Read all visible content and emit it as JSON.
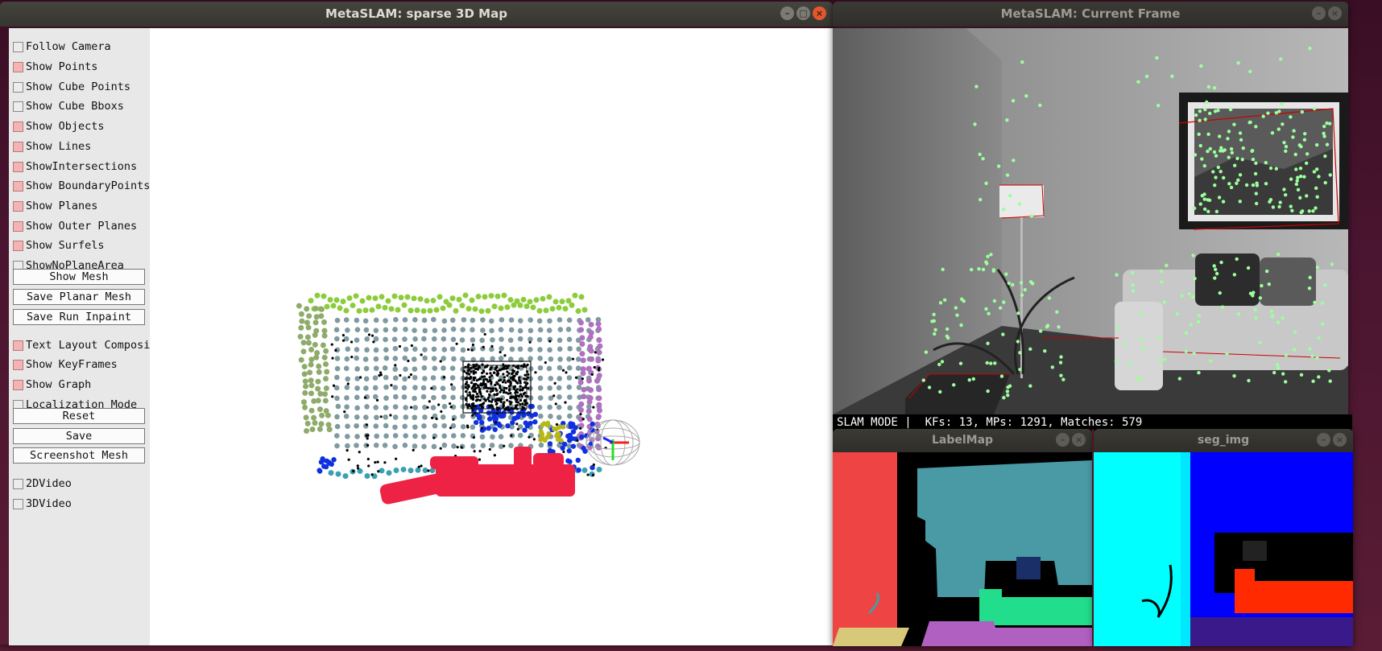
{
  "map_window": {
    "title": "MetaSLAM: sparse 3D Map",
    "controls": [
      {
        "type": "checkbox",
        "label": "Follow Camera",
        "checked": false
      },
      {
        "type": "checkbox",
        "label": "Show Points",
        "checked": true
      },
      {
        "type": "checkbox",
        "label": "Show Cube Points",
        "checked": false
      },
      {
        "type": "checkbox",
        "label": "Show Cube Bboxs",
        "checked": false
      },
      {
        "type": "checkbox",
        "label": "Show Objects",
        "checked": true
      },
      {
        "type": "checkbox",
        "label": "Show Lines",
        "checked": true
      },
      {
        "type": "checkbox",
        "label": "ShowIntersections",
        "checked": true
      },
      {
        "type": "checkbox",
        "label": "Show BoundaryPoints",
        "checked": true
      },
      {
        "type": "checkbox",
        "label": "Show Planes",
        "checked": true
      },
      {
        "type": "checkbox",
        "label": "Show Outer Planes",
        "checked": true
      },
      {
        "type": "checkbox",
        "label": "Show Surfels",
        "checked": true
      },
      {
        "type": "checkbox",
        "label": "ShowNoPlaneArea",
        "checked": false
      },
      {
        "type": "button",
        "label": "Show Mesh"
      },
      {
        "type": "button",
        "label": "Save Planar Mesh"
      },
      {
        "type": "button",
        "label": "Save Run Inpaint"
      },
      {
        "type": "checkbox",
        "label": "Text Layout Composition",
        "checked": true
      },
      {
        "type": "checkbox",
        "label": "Show KeyFrames",
        "checked": true
      },
      {
        "type": "checkbox",
        "label": "Show Graph",
        "checked": true
      },
      {
        "type": "checkbox",
        "label": "Localization Mode",
        "checked": false
      },
      {
        "type": "button",
        "label": "Reset"
      },
      {
        "type": "button",
        "label": "Save"
      },
      {
        "type": "button",
        "label": "Screenshot Mesh"
      },
      {
        "type": "checkbox",
        "label": "2DVideo",
        "checked": false
      },
      {
        "type": "checkbox",
        "label": "3DVideo",
        "checked": false
      }
    ]
  },
  "frame_window": {
    "title": "MetaSLAM: Current Frame",
    "status": "SLAM MODE |  KFs: 13, MPs: 1291, Matches: 579"
  },
  "label_window": {
    "title": "LabelMap"
  },
  "seg_window": {
    "title": "seg_img"
  },
  "window_buttons": {
    "minimize": "–",
    "maximize": "□",
    "close": "×"
  },
  "colors": {
    "checked_box": "#f4b4b4",
    "point_green": "#8ccc3c",
    "point_grey": "#7f9aa0",
    "point_red": "#ee2244",
    "point_blue": "#1030e0",
    "point_teal": "#3aa0b0",
    "point_purple": "#b070c0",
    "keypoint": "#9cff9c"
  }
}
